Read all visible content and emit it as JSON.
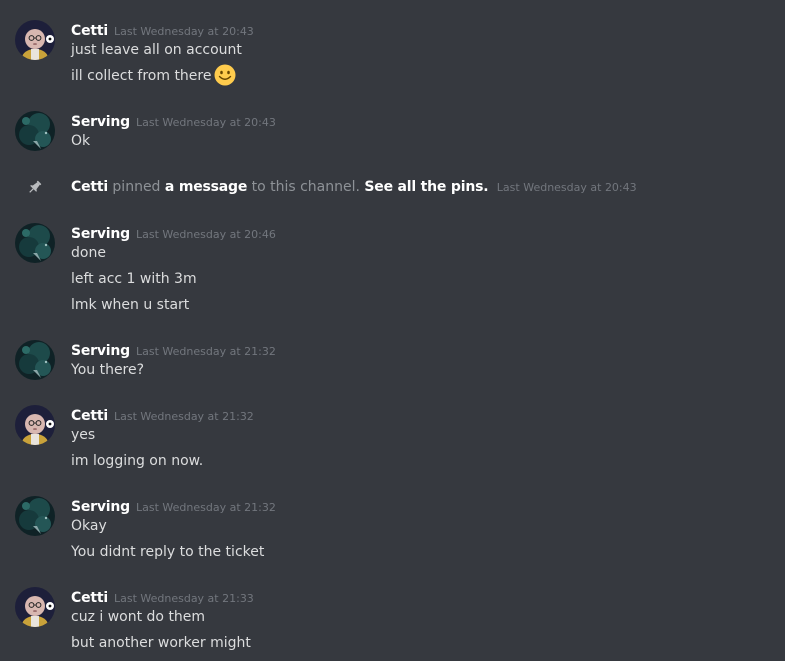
{
  "colors": {
    "background": "#36393f",
    "author": "#ffffff",
    "message_text": "#dcddde",
    "timestamp": "#72767d",
    "muted": "#8e9297"
  },
  "messages": [
    {
      "author": "Cetti",
      "timestamp": "Last Wednesday at 20:43",
      "avatar_icon": "cetti-avatar",
      "lines": [
        "just leave all on account",
        "ill collect from there"
      ],
      "emoji": "slightly-smiling-face-icon"
    },
    {
      "author": "Serving",
      "timestamp": "Last Wednesday at 20:43",
      "avatar_icon": "serving-avatar",
      "lines": [
        "Ok"
      ]
    },
    {
      "author": "Serving",
      "timestamp": "Last Wednesday at 20:46",
      "avatar_icon": "serving-avatar",
      "lines": [
        "done",
        "left acc 1 with 3m",
        "lmk when u start"
      ]
    },
    {
      "author": "Serving",
      "timestamp": "Last Wednesday at 21:32",
      "avatar_icon": "serving-avatar",
      "lines": [
        "You there?"
      ]
    },
    {
      "author": "Cetti",
      "timestamp": "Last Wednesday at 21:32",
      "avatar_icon": "cetti-avatar",
      "lines": [
        "yes",
        "im logging on now."
      ]
    },
    {
      "author": "Serving",
      "timestamp": "Last Wednesday at 21:32",
      "avatar_icon": "serving-avatar",
      "lines": [
        "Okay",
        "You didnt reply to the ticket"
      ]
    },
    {
      "author": "Cetti",
      "timestamp": "Last Wednesday at 21:33",
      "avatar_icon": "cetti-avatar",
      "lines": [
        "cuz i wont do them",
        "but another worker might"
      ]
    }
  ],
  "system_message": {
    "icon": "pin-icon",
    "author": "Cetti",
    "text_pinned": "pinned",
    "link_message": "a message",
    "text_to_channel": "to this channel.",
    "link_see_pins": "See all the pins.",
    "timestamp": "Last Wednesday at 20:43"
  }
}
